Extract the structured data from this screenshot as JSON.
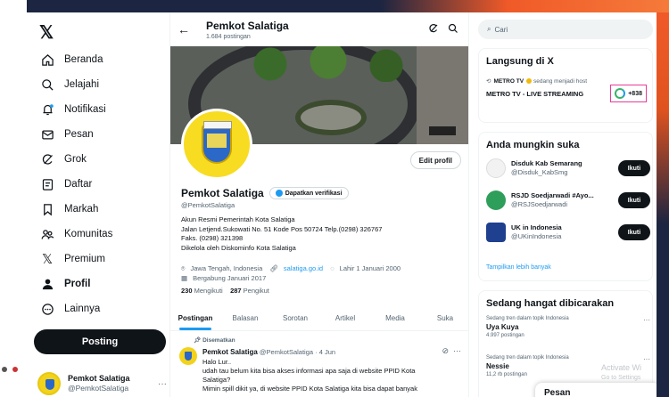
{
  "nav": {
    "items": [
      {
        "label": "Beranda",
        "icon": "home-icon"
      },
      {
        "label": "Jelajahi",
        "icon": "search-icon"
      },
      {
        "label": "Notifikasi",
        "icon": "bell-icon"
      },
      {
        "label": "Pesan",
        "icon": "mail-icon"
      },
      {
        "label": "Grok",
        "icon": "grok-icon"
      },
      {
        "label": "Daftar",
        "icon": "list-icon"
      },
      {
        "label": "Markah",
        "icon": "bookmark-icon"
      },
      {
        "label": "Komunitas",
        "icon": "people-icon"
      },
      {
        "label": "Premium",
        "icon": "x-logo-icon"
      },
      {
        "label": "Profil",
        "icon": "person-icon"
      },
      {
        "label": "Lainnya",
        "icon": "more-circle-icon"
      }
    ],
    "post_button": "Posting",
    "me": {
      "name": "Pemkot Salatiga",
      "handle": "@PemkotSalatiga"
    }
  },
  "header": {
    "title": "Pemkot Salatiga",
    "post_count": "1.684 postingan"
  },
  "profile": {
    "name": "Pemkot Salatiga",
    "verify_label": "Dapatkan verifikasi",
    "handle": "@PemkotSalatiga",
    "edit_label": "Edit profil",
    "bio": [
      "Akun Resmi Pemerintah Kota Salatiga",
      "Jalan Letjend.Sukowati No. 51 Kode Pos 50724 Telp.(0298) 326767",
      "Faks. (0298) 321398",
      "Dikelola oleh Diskominfo Kota Salatiga"
    ],
    "location": "Jawa Tengah, Indonesia",
    "website": "salatiga.go.id",
    "birth": "Lahir 1 Januari 2000",
    "joined": "Bergabung Januari 2017",
    "following_count": "230",
    "following_label": "Mengikuti",
    "followers_count": "287",
    "followers_label": "Pengikut"
  },
  "tabs": [
    "Postingan",
    "Balasan",
    "Sorotan",
    "Artikel",
    "Media",
    "Suka"
  ],
  "post": {
    "pinned": "Disematkan",
    "name": "Pemkot Salatiga",
    "meta": "@PemkotSalatiga · 4 Jun",
    "lines": [
      "Halo Lur..",
      "udah tau belum kita bisa akses informasi apa saja di website PPID Kota",
      "Salatiga?",
      "Mimin spill dikit ya, di website PPID Kota Salatiga kita bisa dapat banyak"
    ]
  },
  "right": {
    "search_placeholder": "Cari",
    "live": {
      "title": "Langsung di X",
      "host": "METRO TV",
      "host_note": "sedang menjadi host",
      "stream_title": "METRO TV - LIVE STREAMING",
      "count": "+838"
    },
    "suggest": {
      "title": "Anda mungkin suka",
      "items": [
        {
          "name": "Disduk Kab Semarang",
          "handle": "@Disduk_KabSmg",
          "follow": "Ikuti",
          "color": "#f2f2f2"
        },
        {
          "name": "RSJD Soedjarwadi #Ayo...",
          "handle": "@RSJSoedjarwadi",
          "follow": "Ikuti",
          "color": "#2e9e5b"
        },
        {
          "name": "UK in Indonesia",
          "handle": "@UKinIndonesia",
          "follow": "Ikuti",
          "color": "#1f3f8f"
        }
      ],
      "show_more": "Tampilkan lebih banyak"
    },
    "trends": {
      "title": "Sedang hangat dibicarakan",
      "items": [
        {
          "context": "Sedang tren dalam topik Indonesia",
          "topic": "Uya Kuya",
          "count": "4.997 postingan"
        },
        {
          "context": "Sedang tren dalam topik Indonesia",
          "topic": "Nessie",
          "count": "11,2 rb postingan"
        }
      ]
    }
  },
  "overlay": {
    "activate": "Activate Wi",
    "activate2": "Go to Settings",
    "messages": "Pesan"
  }
}
